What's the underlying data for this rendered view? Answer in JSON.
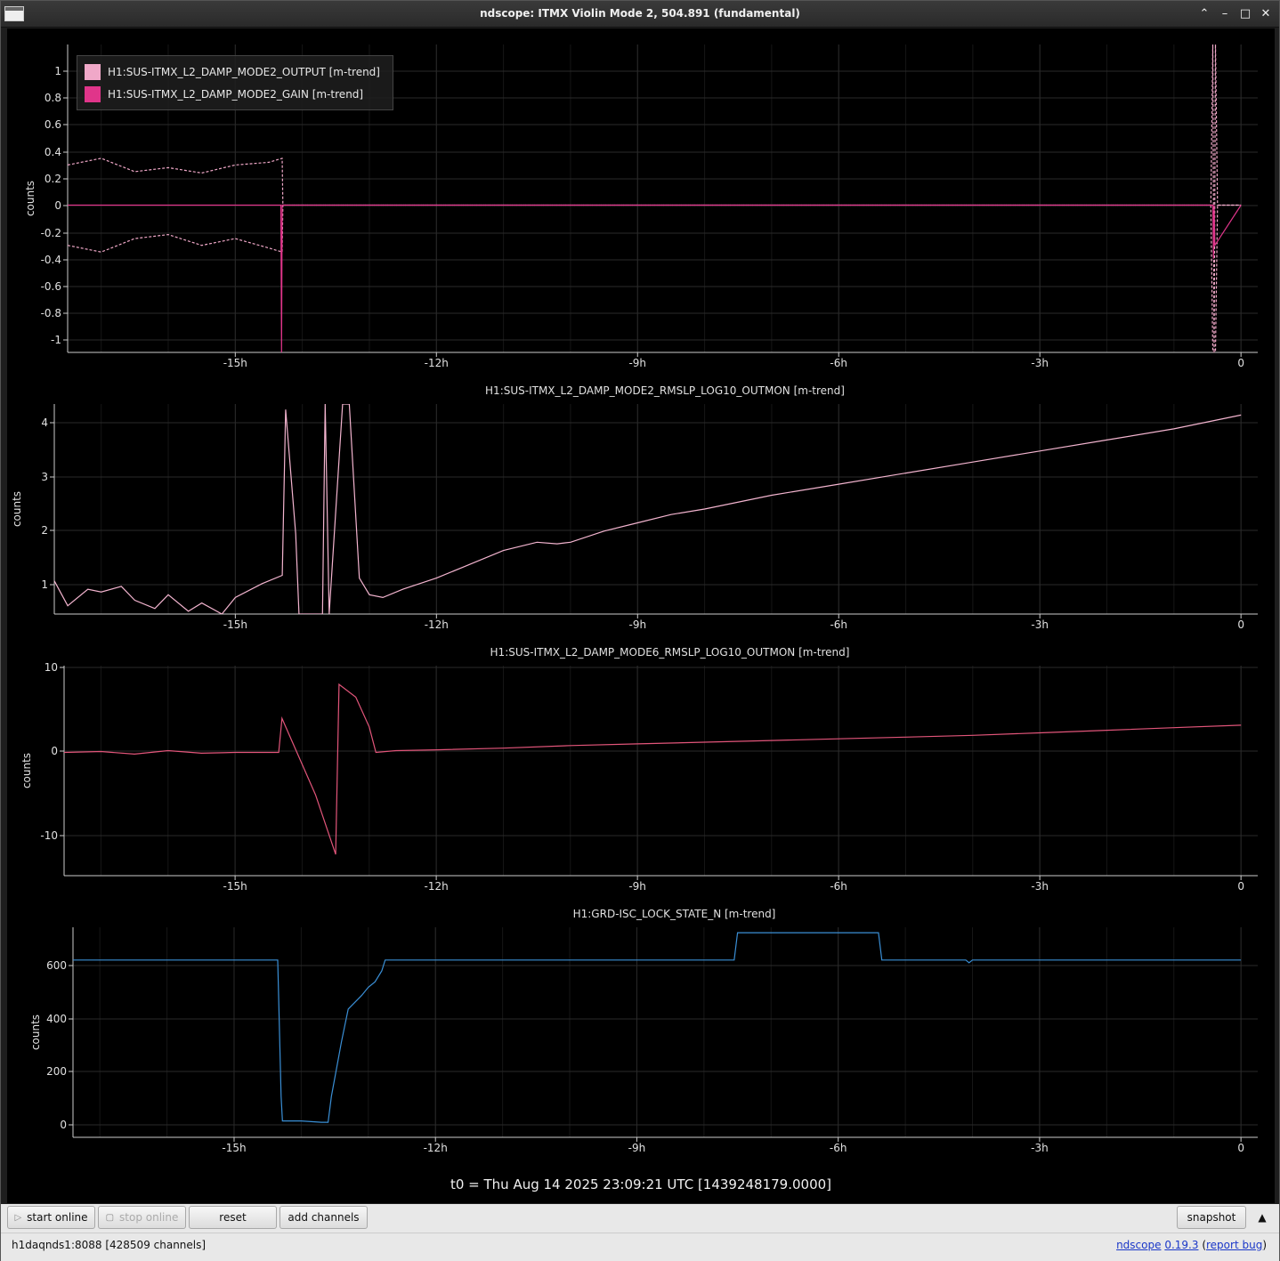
{
  "window": {
    "title": "ndscope: ITMX Violin Mode 2, 504.891 (fundamental)",
    "buttons": [
      "⌃",
      "–",
      "□",
      "✕"
    ]
  },
  "x_ticks": [
    "-15h",
    "-12h",
    "-9h",
    "-6h",
    "-3h",
    "0"
  ],
  "colors": {
    "background": "#000000",
    "grid": "#2a2a2a",
    "axis": "#cccccc",
    "output": "#f0a8c8",
    "gain": "#e0358a",
    "mode2_rms": "#f3b4cf",
    "mode6_rms": "#e2557a",
    "lock_state": "#3a8fd6"
  },
  "plots": [
    {
      "title": "",
      "ylabel": "counts",
      "yticks": [
        "1",
        "0.8",
        "0.6",
        "0.4",
        "0.2",
        "0",
        "-0.2",
        "-0.4",
        "-0.6",
        "-0.8",
        "-1"
      ],
      "legend": [
        {
          "label": "H1:SUS-ITMX_L2_DAMP_MODE2_OUTPUT [m-trend]",
          "color": "#f0a8c8"
        },
        {
          "label": "H1:SUS-ITMX_L2_DAMP_MODE2_GAIN [m-trend]",
          "color": "#e0358a"
        }
      ]
    },
    {
      "title": "H1:SUS-ITMX_L2_DAMP_MODE2_RMSLP_LOG10_OUTMON [m-trend]",
      "ylabel": "counts",
      "yticks": [
        "4",
        "3",
        "2",
        "1"
      ]
    },
    {
      "title": "H1:SUS-ITMX_L2_DAMP_MODE6_RMSLP_LOG10_OUTMON [m-trend]",
      "ylabel": "counts",
      "yticks": [
        "10",
        "0",
        "-10"
      ]
    },
    {
      "title": "H1:GRD-ISC_LOCK_STATE_N [m-trend]",
      "ylabel": "counts",
      "yticks": [
        "600",
        "400",
        "200",
        "0"
      ]
    }
  ],
  "chart_data": [
    {
      "type": "line",
      "xlabel": "",
      "ylabel": "counts",
      "xlim": [
        -17.5,
        0.25
      ],
      "ylim": [
        -1.1,
        1.2
      ],
      "series": [
        {
          "name": "H1:SUS-ITMX_L2_DAMP_MODE2_OUTPUT [m-trend]",
          "x": [
            -17.5,
            -17.0,
            -16.5,
            -16.0,
            -15.5,
            -15.0,
            -14.5,
            -14.3,
            -14.29,
            -0.45,
            -0.42,
            -0.4,
            -0.38,
            -0.35,
            0.0
          ],
          "y": [
            0.3,
            0.35,
            0.25,
            0.28,
            0.24,
            0.3,
            0.32,
            0.35,
            0.0,
            0.0,
            1.2,
            -1.1,
            1.2,
            0.0,
            0.0
          ],
          "y_min": [
            -0.3,
            -0.35,
            -0.25,
            -0.22,
            -0.3,
            -0.25,
            -0.32,
            -0.35,
            0.0,
            0.0,
            -1.1,
            -1.1,
            -1.1,
            0.0,
            0.0
          ]
        },
        {
          "name": "H1:SUS-ITMX_L2_DAMP_MODE2_GAIN [m-trend]",
          "x": [
            -17.5,
            -14.32,
            -14.31,
            -14.3,
            -0.42,
            -0.41,
            -0.4,
            -0.39,
            0.0
          ],
          "y": [
            0.0,
            0.0,
            -1.1,
            0.0,
            0.0,
            -0.4,
            0.0,
            -0.3,
            0.0
          ]
        }
      ]
    },
    {
      "type": "line",
      "xlabel": "",
      "ylabel": "counts",
      "xlim": [
        -17.7,
        0.25
      ],
      "ylim": [
        0.55,
        4.35
      ],
      "series": [
        {
          "name": "H1:SUS-ITMX_L2_DAMP_MODE2_RMSLP_LOG10_OUTMON [m-trend]",
          "x": [
            -17.7,
            -17.5,
            -17.2,
            -17.0,
            -16.7,
            -16.5,
            -16.2,
            -16.0,
            -15.7,
            -15.5,
            -15.2,
            -15.0,
            -14.6,
            -14.3,
            -14.25,
            -14.1,
            -14.05,
            -13.7,
            -13.66,
            -13.6,
            -13.4,
            -13.3,
            -13.15,
            -13.0,
            -12.8,
            -12.5,
            -12.0,
            -11.5,
            -11.0,
            -10.5,
            -10.2,
            -10.0,
            -9.5,
            -9.0,
            -8.5,
            -8.0,
            -7.0,
            -6.0,
            -5.0,
            -4.0,
            -3.0,
            -2.0,
            -1.0,
            0.0
          ],
          "y": [
            1.15,
            0.7,
            1.0,
            0.95,
            1.05,
            0.8,
            0.65,
            0.9,
            0.6,
            0.75,
            0.55,
            0.85,
            1.1,
            1.25,
            4.25,
            2.0,
            0.55,
            0.55,
            4.35,
            0.55,
            4.35,
            4.35,
            1.2,
            0.9,
            0.85,
            1.0,
            1.2,
            1.45,
            1.7,
            1.85,
            1.82,
            1.85,
            2.05,
            2.2,
            2.35,
            2.45,
            2.7,
            2.9,
            3.1,
            3.3,
            3.5,
            3.7,
            3.9,
            4.15
          ]
        }
      ]
    },
    {
      "type": "line",
      "xlabel": "",
      "ylabel": "counts",
      "xlim": [
        -17.55,
        0.25
      ],
      "ylim": [
        -14.5,
        10.2
      ],
      "series": [
        {
          "name": "H1:SUS-ITMX_L2_DAMP_MODE6_RMSLP_LOG10_OUTMON [m-trend]",
          "x": [
            -17.55,
            -17.0,
            -16.5,
            -16.0,
            -15.5,
            -15.0,
            -14.6,
            -14.35,
            -14.3,
            -13.8,
            -13.5,
            -13.45,
            -13.2,
            -13.0,
            -12.9,
            -12.6,
            -12.0,
            -11.0,
            -10.0,
            -9.0,
            -8.0,
            -7.0,
            -6.0,
            -5.0,
            -4.0,
            -3.0,
            -2.0,
            -1.0,
            0.0
          ],
          "y": [
            0.0,
            0.1,
            -0.2,
            0.2,
            -0.1,
            0.0,
            0.0,
            0.0,
            4.0,
            -5.0,
            -12.0,
            8.0,
            6.5,
            3.0,
            0.0,
            0.2,
            0.3,
            0.5,
            0.8,
            1.0,
            1.2,
            1.4,
            1.6,
            1.8,
            2.0,
            2.3,
            2.6,
            2.9,
            3.2
          ]
        }
      ]
    },
    {
      "type": "line",
      "xlabel": "",
      "ylabel": "counts",
      "xlim": [
        -17.4,
        0.25
      ],
      "ylim": [
        -50,
        720
      ],
      "series": [
        {
          "name": "H1:GRD-ISC_LOCK_STATE_N [m-trend]",
          "x": [
            -17.4,
            -14.35,
            -14.3,
            -14.28,
            -14.0,
            -13.7,
            -13.6,
            -13.55,
            -13.4,
            -13.3,
            -13.1,
            -13.0,
            -12.9,
            -12.8,
            -12.75,
            -12.7,
            -7.55,
            -7.5,
            -5.4,
            -5.35,
            -4.1,
            -4.05,
            -4.0,
            0.0
          ],
          "y": [
            600,
            600,
            100,
            10,
            10,
            5,
            5,
            100,
            300,
            420,
            470,
            500,
            520,
            560,
            600,
            600,
            600,
            700,
            700,
            600,
            600,
            590,
            600,
            600
          ]
        }
      ]
    }
  ],
  "t0_label": "t0 = Thu Aug 14 2025 23:09:21 UTC [1439248179.0000]",
  "toolbar": {
    "start_online": "start online",
    "stop_online": "stop online",
    "reset": "reset",
    "add_channels": "add channels",
    "snapshot": "snapshot",
    "expand": "▲"
  },
  "status": {
    "server": "h1daqnds1:8088  [428509 channels]",
    "app_name": "ndscope",
    "version": "0.19.3",
    "report_bug": "report bug"
  }
}
